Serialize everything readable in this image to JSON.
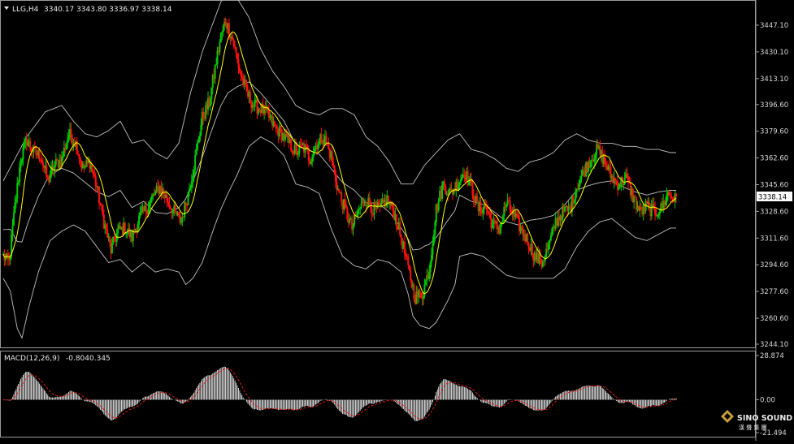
{
  "header": {
    "symbol": "LLG,H4",
    "ohlc": "3340.17 3343.80 3336.97 3338.14"
  },
  "macd": {
    "label": "MACD(12,26,9)",
    "main": "-0.804",
    "signal": "0.345",
    "ticks": [
      "28.874",
      "0.00",
      "-21.494"
    ]
  },
  "price_axis": {
    "ticks": [
      "3447.10",
      "3430.10",
      "3413.10",
      "3396.60",
      "3379.60",
      "3362.60",
      "3345.60",
      "3328.60",
      "3311.60",
      "3294.60",
      "3277.60",
      "3260.60",
      "3244.10"
    ],
    "current": "3338.14"
  },
  "logo": {
    "name": "SINO SOUND",
    "sub": "漢 聲 集 團"
  },
  "colors": {
    "up": "#00c800",
    "down": "#ff1010",
    "ma": "#ffff00",
    "band": "#c0c0c0",
    "signal": "#e01818",
    "hist": "#ffffff"
  },
  "chart_data": {
    "type": "candlestick",
    "title": "LLG,H4",
    "ylim": [
      3244.1,
      3447.1
    ],
    "anchors_close": [
      [
        0,
        3300
      ],
      [
        5,
        3296
      ],
      [
        10,
        3332
      ],
      [
        15,
        3362
      ],
      [
        20,
        3374
      ],
      [
        26,
        3366
      ],
      [
        32,
        3364
      ],
      [
        38,
        3348
      ],
      [
        44,
        3358
      ],
      [
        50,
        3362
      ],
      [
        56,
        3378
      ],
      [
        62,
        3372
      ],
      [
        68,
        3356
      ],
      [
        74,
        3360
      ],
      [
        80,
        3344
      ],
      [
        86,
        3322
      ],
      [
        92,
        3304
      ],
      [
        98,
        3316
      ],
      [
        104,
        3318
      ],
      [
        110,
        3312
      ],
      [
        116,
        3324
      ],
      [
        122,
        3330
      ],
      [
        128,
        3338
      ],
      [
        134,
        3344
      ],
      [
        140,
        3336
      ],
      [
        146,
        3328
      ],
      [
        152,
        3322
      ],
      [
        158,
        3340
      ],
      [
        164,
        3362
      ],
      [
        170,
        3388
      ],
      [
        176,
        3398
      ],
      [
        182,
        3424
      ],
      [
        186,
        3440
      ],
      [
        190,
        3450
      ],
      [
        196,
        3438
      ],
      [
        202,
        3418
      ],
      [
        208,
        3404
      ],
      [
        214,
        3396
      ],
      [
        220,
        3394
      ],
      [
        226,
        3390
      ],
      [
        232,
        3382
      ],
      [
        238,
        3378
      ],
      [
        244,
        3372
      ],
      [
        250,
        3366
      ],
      [
        256,
        3370
      ],
      [
        262,
        3362
      ],
      [
        268,
        3372
      ],
      [
        274,
        3376
      ],
      [
        280,
        3364
      ],
      [
        286,
        3342
      ],
      [
        292,
        3330
      ],
      [
        298,
        3318
      ],
      [
        304,
        3330
      ],
      [
        310,
        3336
      ],
      [
        316,
        3330
      ],
      [
        322,
        3330
      ],
      [
        328,
        3336
      ],
      [
        334,
        3328
      ],
      [
        340,
        3312
      ],
      [
        346,
        3292
      ],
      [
        352,
        3274
      ],
      [
        358,
        3276
      ],
      [
        364,
        3292
      ],
      [
        370,
        3330
      ],
      [
        376,
        3346
      ],
      [
        382,
        3340
      ],
      [
        388,
        3346
      ],
      [
        394,
        3354
      ],
      [
        400,
        3344
      ],
      [
        406,
        3330
      ],
      [
        412,
        3332
      ],
      [
        418,
        3320
      ],
      [
        424,
        3318
      ],
      [
        430,
        3334
      ],
      [
        436,
        3326
      ],
      [
        442,
        3318
      ],
      [
        448,
        3310
      ],
      [
        454,
        3300
      ],
      [
        460,
        3296
      ],
      [
        466,
        3306
      ],
      [
        472,
        3322
      ],
      [
        478,
        3328
      ],
      [
        484,
        3330
      ],
      [
        490,
        3344
      ],
      [
        496,
        3354
      ],
      [
        502,
        3362
      ],
      [
        508,
        3368
      ],
      [
        514,
        3360
      ],
      [
        520,
        3350
      ],
      [
        526,
        3346
      ],
      [
        532,
        3350
      ],
      [
        538,
        3338
      ],
      [
        544,
        3328
      ],
      [
        550,
        3332
      ],
      [
        556,
        3328
      ],
      [
        562,
        3330
      ],
      [
        568,
        3340
      ],
      [
        574,
        3336
      ]
    ],
    "bb_upper": [
      [
        0,
        3348
      ],
      [
        20,
        3376
      ],
      [
        36,
        3392
      ],
      [
        50,
        3396
      ],
      [
        60,
        3386
      ],
      [
        70,
        3378
      ],
      [
        80,
        3376
      ],
      [
        90,
        3380
      ],
      [
        100,
        3386
      ],
      [
        110,
        3372
      ],
      [
        120,
        3374
      ],
      [
        130,
        3366
      ],
      [
        140,
        3362
      ],
      [
        150,
        3372
      ],
      [
        160,
        3404
      ],
      [
        170,
        3430
      ],
      [
        180,
        3450
      ],
      [
        186,
        3462
      ],
      [
        192,
        3468
      ],
      [
        200,
        3464
      ],
      [
        210,
        3452
      ],
      [
        220,
        3432
      ],
      [
        230,
        3418
      ],
      [
        240,
        3408
      ],
      [
        250,
        3396
      ],
      [
        260,
        3392
      ],
      [
        270,
        3390
      ],
      [
        280,
        3394
      ],
      [
        290,
        3394
      ],
      [
        300,
        3390
      ],
      [
        310,
        3376
      ],
      [
        320,
        3370
      ],
      [
        330,
        3360
      ],
      [
        340,
        3346
      ],
      [
        350,
        3346
      ],
      [
        360,
        3358
      ],
      [
        370,
        3366
      ],
      [
        380,
        3374
      ],
      [
        390,
        3378
      ],
      [
        400,
        3368
      ],
      [
        410,
        3366
      ],
      [
        420,
        3362
      ],
      [
        430,
        3356
      ],
      [
        440,
        3354
      ],
      [
        450,
        3360
      ],
      [
        460,
        3362
      ],
      [
        470,
        3366
      ],
      [
        480,
        3374
      ],
      [
        490,
        3378
      ],
      [
        500,
        3374
      ],
      [
        510,
        3372
      ],
      [
        520,
        3372
      ],
      [
        530,
        3370
      ],
      [
        540,
        3370
      ],
      [
        550,
        3368
      ],
      [
        560,
        3368
      ],
      [
        570,
        3366
      ],
      [
        575,
        3366
      ]
    ],
    "bb_lower": [
      [
        0,
        3286
      ],
      [
        6,
        3278
      ],
      [
        12,
        3254
      ],
      [
        16,
        3248
      ],
      [
        22,
        3268
      ],
      [
        30,
        3290
      ],
      [
        40,
        3310
      ],
      [
        50,
        3316
      ],
      [
        60,
        3320
      ],
      [
        70,
        3316
      ],
      [
        80,
        3306
      ],
      [
        90,
        3296
      ],
      [
        100,
        3298
      ],
      [
        110,
        3290
      ],
      [
        120,
        3296
      ],
      [
        130,
        3290
      ],
      [
        140,
        3292
      ],
      [
        150,
        3290
      ],
      [
        156,
        3282
      ],
      [
        162,
        3286
      ],
      [
        170,
        3296
      ],
      [
        180,
        3318
      ],
      [
        186,
        3330
      ],
      [
        192,
        3340
      ],
      [
        200,
        3352
      ],
      [
        210,
        3370
      ],
      [
        220,
        3376
      ],
      [
        230,
        3372
      ],
      [
        240,
        3364
      ],
      [
        250,
        3346
      ],
      [
        260,
        3344
      ],
      [
        270,
        3340
      ],
      [
        280,
        3318
      ],
      [
        290,
        3300
      ],
      [
        300,
        3294
      ],
      [
        310,
        3292
      ],
      [
        320,
        3298
      ],
      [
        330,
        3296
      ],
      [
        340,
        3290
      ],
      [
        346,
        3276
      ],
      [
        350,
        3262
      ],
      [
        356,
        3256
      ],
      [
        364,
        3254
      ],
      [
        370,
        3258
      ],
      [
        380,
        3272
      ],
      [
        386,
        3282
      ],
      [
        390,
        3300
      ],
      [
        400,
        3302
      ],
      [
        410,
        3300
      ],
      [
        420,
        3294
      ],
      [
        430,
        3288
      ],
      [
        440,
        3286
      ],
      [
        450,
        3286
      ],
      [
        460,
        3286
      ],
      [
        470,
        3286
      ],
      [
        480,
        3292
      ],
      [
        490,
        3306
      ],
      [
        500,
        3316
      ],
      [
        510,
        3322
      ],
      [
        520,
        3324
      ],
      [
        530,
        3318
      ],
      [
        540,
        3312
      ],
      [
        550,
        3310
      ],
      [
        560,
        3314
      ],
      [
        570,
        3318
      ],
      [
        575,
        3318
      ]
    ]
  }
}
